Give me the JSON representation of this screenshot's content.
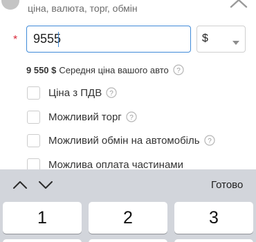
{
  "section": {
    "subtitle": "ціна, валюта, торг, обмін"
  },
  "price": {
    "required_mark": "*",
    "value": "9555",
    "currency": "$"
  },
  "average": {
    "price": "9 550 $",
    "label": "Середня ціна вашого авто"
  },
  "options": [
    {
      "label": "Ціна з ПДВ",
      "has_info": true,
      "checked": false
    },
    {
      "label": "Можливий торг",
      "has_info": true,
      "checked": false
    },
    {
      "label": "Можливий обмін на автомобіль",
      "has_info": true,
      "checked": false
    },
    {
      "label": "Можлива оплата частинами",
      "has_info": false,
      "checked": false
    }
  ],
  "keyboard": {
    "done_label": "Готово",
    "prev_icon": "chevron-up-icon",
    "next_icon": "chevron-down-icon",
    "keys": [
      "1",
      "2",
      "3"
    ]
  },
  "colors": {
    "accent": "#3f8ad8",
    "required": "#d9293a",
    "keyboard_bg": "#d2d5db"
  }
}
